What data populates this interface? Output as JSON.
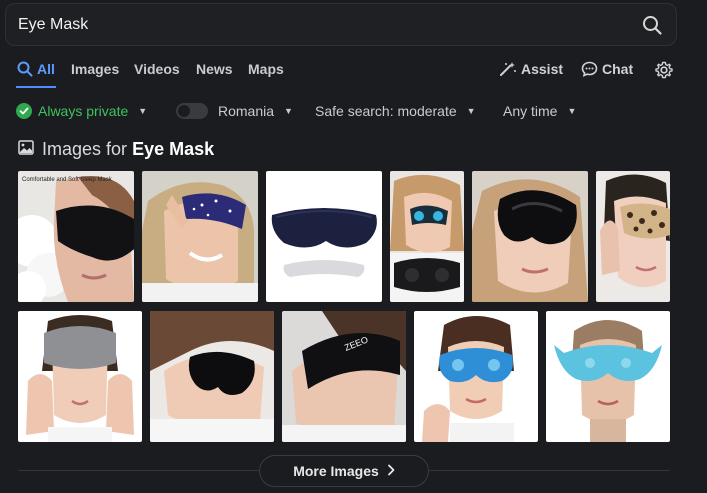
{
  "search": {
    "query": "Eye Mask"
  },
  "tabs": [
    {
      "label": "All",
      "active": true
    },
    {
      "label": "Images"
    },
    {
      "label": "Videos"
    },
    {
      "label": "News"
    },
    {
      "label": "Maps"
    }
  ],
  "tools": {
    "assist_label": "Assist",
    "chat_label": "Chat"
  },
  "filters": {
    "privacy": "Always private",
    "region": "Romania",
    "safe_search": "Safe search: moderate",
    "time": "Any time"
  },
  "images_section": {
    "prefix": "Images for",
    "query": "Eye Mask"
  },
  "thumbnail_text": {
    "first_caption": "Comfortable and\nSoft Sleep Mask",
    "brand": "ZEEO"
  },
  "more_button": {
    "label": "More Images"
  },
  "colors": {
    "accent": "#4d8eff",
    "private_green": "#2fa84f",
    "background": "#1b1c20"
  }
}
